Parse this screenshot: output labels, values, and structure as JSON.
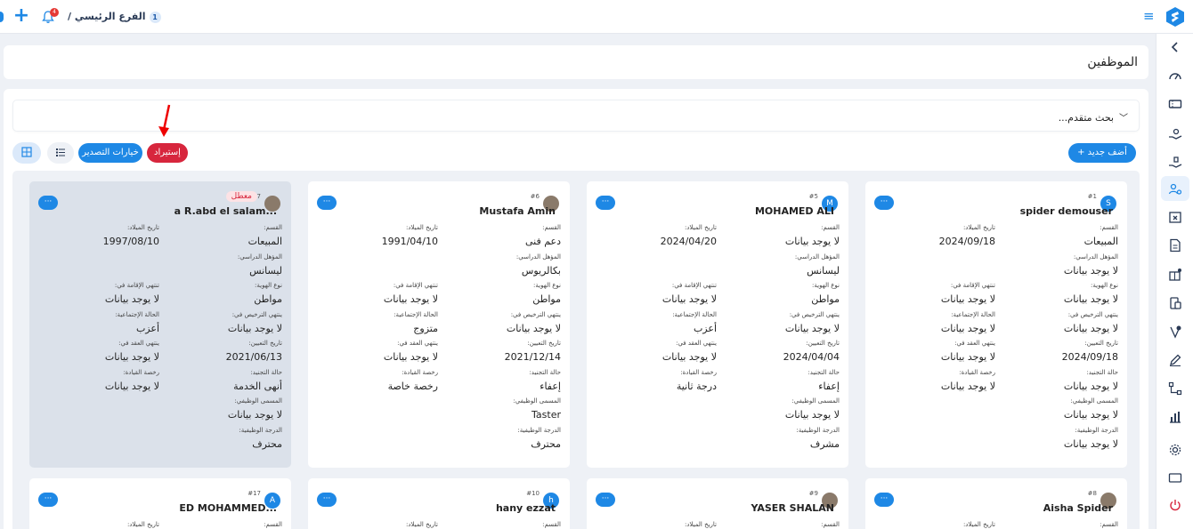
{
  "topbar": {
    "branch": "الفرع الرئيسي /",
    "branch_count": "1",
    "notifications": "4"
  },
  "page_title": "الموظفين",
  "search": {
    "label": "بحث متقدم..."
  },
  "toolbar": {
    "add": "أضف جديد",
    "import": "إستيراد",
    "export": "خيارات التصدير"
  },
  "employees": [
    {
      "num": "#1",
      "name": "spider demouser",
      "avatar": "S",
      "status": "",
      "fields": [
        [
          "القسم:",
          "المبيعات",
          "تاريخ الميلاد:",
          "2024/09/18"
        ],
        [
          "المؤهل الدراسي:",
          "لا يوجد بيانات",
          "",
          ""
        ],
        [
          "نوع الهوية:",
          "لا يوجد بيانات",
          "تنتهي الإقامة في:",
          "لا يوجد بيانات"
        ],
        [
          "ينتهي الترخيص في:",
          "لا يوجد بيانات",
          "الحالة الإجتماعية:",
          "لا يوجد بيانات"
        ],
        [
          "تاريخ التعيين:",
          "2024/09/18",
          "ينتهي العقد في:",
          "لا يوجد بيانات"
        ],
        [
          "حالة التجنيد:",
          "لا يوجد بيانات",
          "رخصة القيادة:",
          "لا يوجد بيانات"
        ],
        [
          "المسمى الوظيفي:",
          "لا يوجد بيانات",
          "",
          ""
        ],
        [
          "الدرجة الوظيفية:",
          "لا يوجد بيانات",
          "",
          ""
        ]
      ]
    },
    {
      "num": "#5",
      "name": "MOHAMED ALI",
      "avatar": "M",
      "status": "",
      "fields": [
        [
          "القسم:",
          "لا يوجد بيانات",
          "تاريخ الميلاد:",
          "2024/04/20"
        ],
        [
          "المؤهل الدراسي:",
          "ليسانس",
          "",
          ""
        ],
        [
          "نوع الهوية:",
          "مواطن",
          "تنتهي الإقامة في:",
          "لا يوجد بيانات"
        ],
        [
          "ينتهي الترخيص في:",
          "لا يوجد بيانات",
          "الحالة الإجتماعية:",
          "أعزب"
        ],
        [
          "تاريخ التعيين:",
          "2024/04/04",
          "ينتهي العقد في:",
          "لا يوجد بيانات"
        ],
        [
          "حالة التجنيد:",
          "إعفاء",
          "رخصة القيادة:",
          "درجة ثانية"
        ],
        [
          "المسمى الوظيفي:",
          "لا يوجد بيانات",
          "",
          ""
        ],
        [
          "الدرجة الوظيفية:",
          "مشرف",
          "",
          ""
        ]
      ]
    },
    {
      "num": "#6",
      "name": "Mustafa Amin",
      "avatar": "",
      "status": "",
      "fields": [
        [
          "القسم:",
          "دعم فنى",
          "تاريخ الميلاد:",
          "1991/04/10"
        ],
        [
          "المؤهل الدراسي:",
          "بكالريوس",
          "",
          ""
        ],
        [
          "نوع الهوية:",
          "مواطن",
          "تنتهي الإقامة في:",
          "لا يوجد بيانات"
        ],
        [
          "ينتهي الترخيص في:",
          "لا يوجد بيانات",
          "الحالة الإجتماعية:",
          "متزوج"
        ],
        [
          "تاريخ التعيين:",
          "2021/12/14",
          "ينتهي العقد في:",
          "لا يوجد بيانات"
        ],
        [
          "حالة التجنيد:",
          "إعفاء",
          "رخصة القيادة:",
          "رخصة خاصة"
        ],
        [
          "المسمى الوظيفي:",
          "Taster",
          "",
          ""
        ],
        [
          "الدرجة الوظيفية:",
          "محترف",
          "",
          ""
        ]
      ]
    },
    {
      "num": "#7",
      "name": "a R.abd el salam...",
      "avatar": "",
      "status": "معطل",
      "fields": [
        [
          "القسم:",
          "المبيعات",
          "تاريخ الميلاد:",
          "1997/08/10"
        ],
        [
          "المؤهل الدراسي:",
          "ليسانس",
          "",
          ""
        ],
        [
          "نوع الهوية:",
          "مواطن",
          "تنتهي الإقامة في:",
          "لا يوجد بيانات"
        ],
        [
          "ينتهي الترخيص في:",
          "لا يوجد بيانات",
          "الحالة الإجتماعية:",
          "أعزب"
        ],
        [
          "تاريخ التعيين:",
          "2021/06/13",
          "ينتهي العقد في:",
          "لا يوجد بيانات"
        ],
        [
          "حالة التجنيد:",
          "أنهى الخدمة",
          "رخصة القيادة:",
          "لا يوجد بيانات"
        ],
        [
          "المسمى الوظيفي:",
          "لا يوجد بيانات",
          "",
          ""
        ],
        [
          "الدرجة الوظيفية:",
          "محترف",
          "",
          ""
        ]
      ]
    },
    {
      "num": "#8",
      "name": "Aisha Spider",
      "avatar": "",
      "status": "",
      "fields": [
        [
          "القسم:",
          "",
          "تاريخ الميلاد:",
          ""
        ]
      ]
    },
    {
      "num": "#9",
      "name": "YASER SHALAN",
      "avatar": "",
      "status": "",
      "fields": [
        [
          "القسم:",
          "",
          "تاريخ الميلاد:",
          ""
        ]
      ]
    },
    {
      "num": "#10",
      "name": "hany ezzat",
      "avatar": "h",
      "status": "",
      "fields": [
        [
          "القسم:",
          "",
          "تاريخ الميلاد:",
          ""
        ]
      ]
    },
    {
      "num": "#17",
      "name": "ED MOHAMMED...",
      "avatar": "A",
      "status": "",
      "fields": [
        [
          "القسم:",
          "",
          "تاريخ الميلاد:",
          ""
        ]
      ]
    }
  ],
  "card_menu": "···",
  "colors": {
    "primary": "#1e88e5",
    "danger": "#d7263d",
    "disabled_card": "#dbe1ea"
  }
}
